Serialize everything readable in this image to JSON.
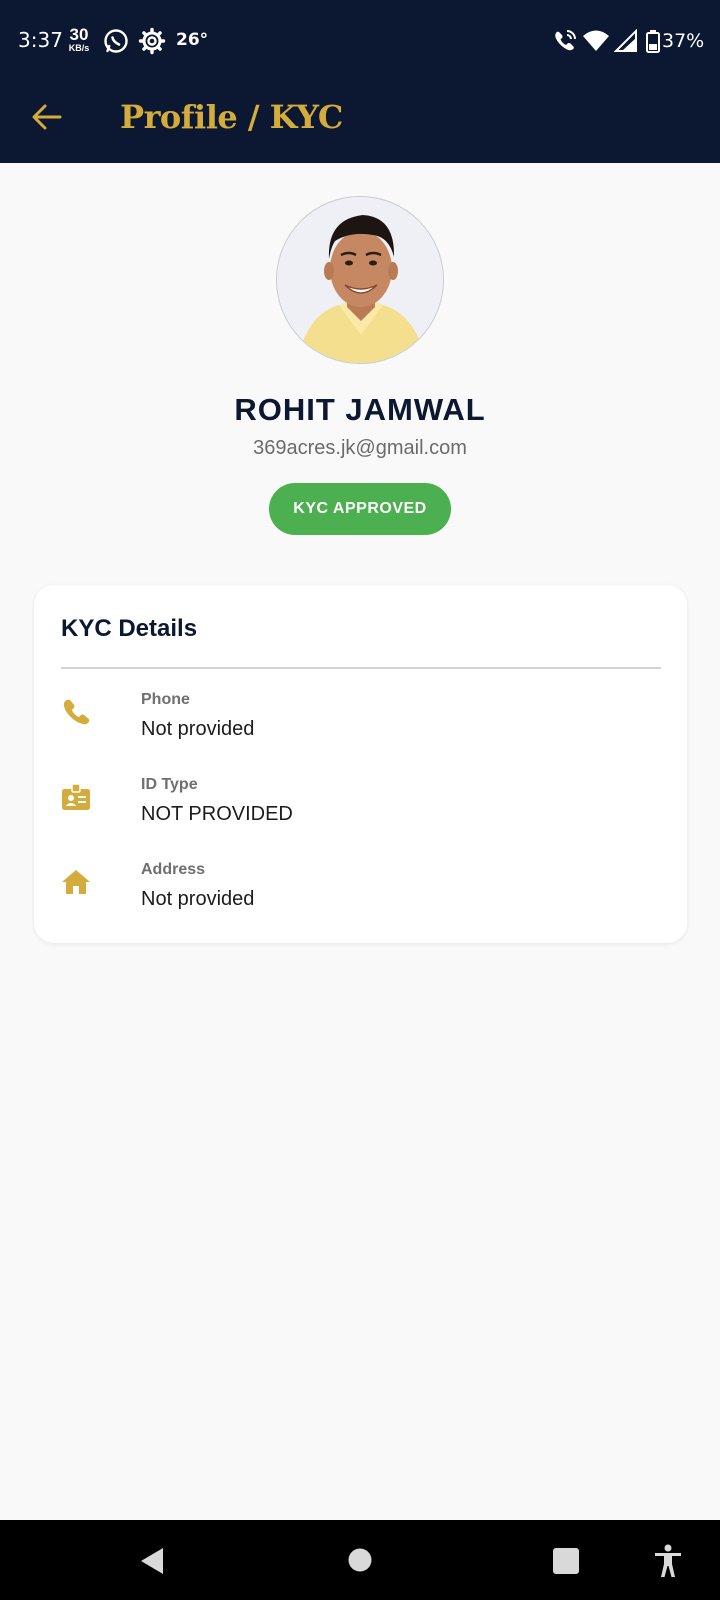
{
  "status_bar": {
    "time": "3:37",
    "net_speed_value": "30",
    "net_speed_unit": "KB/s",
    "temperature": "26°",
    "battery": "37%"
  },
  "header": {
    "title": "Profile / KYC"
  },
  "profile": {
    "name": "ROHIT JAMWAL",
    "email": "369acres.jk@gmail.com",
    "kyc_status": "KYC APPROVED"
  },
  "kyc_details": {
    "title": "KYC Details",
    "rows": [
      {
        "icon": "phone-icon",
        "label": "Phone",
        "value": "Not provided"
      },
      {
        "icon": "id-card-icon",
        "label": "ID Type",
        "value": "NOT PROVIDED"
      },
      {
        "icon": "home-icon",
        "label": "Address",
        "value": "Not provided"
      }
    ]
  },
  "colors": {
    "header_bg": "#0c1831",
    "accent_gold": "#d4ac3c",
    "approved_green": "#4caf50",
    "page_bg": "#f9f9f9"
  }
}
